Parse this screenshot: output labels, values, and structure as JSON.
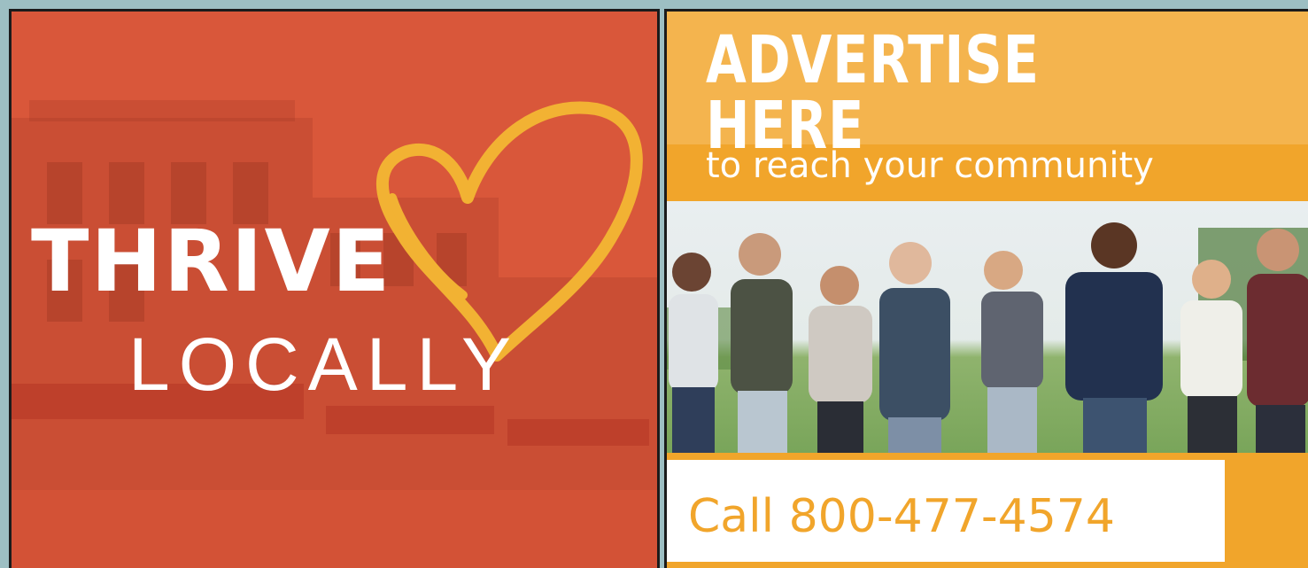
{
  "left_ad": {
    "line1": "THRIVE",
    "line2": "LOCALLY",
    "background_color": "#d9573a",
    "heart_color": "#f2b233",
    "heart_icon": "heart-outline-icon"
  },
  "right_ad": {
    "headline": "ADVERTISE HERE",
    "subheadline": "to reach your community",
    "call_text": "Call 800-477-4574",
    "background_color": "#f1a52b",
    "photo": "group-of-people-photo"
  }
}
